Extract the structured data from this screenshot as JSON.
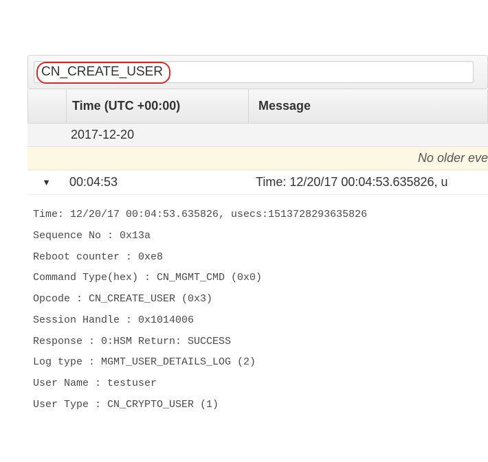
{
  "search": {
    "value": "CN_CREATE_USER"
  },
  "columns": {
    "time": "Time (UTC +00:00)",
    "message": "Message"
  },
  "date_group": "2017-12-20",
  "notice": "No older eve",
  "event": {
    "time": "00:04:53",
    "message": "Time: 12/20/17 00:04:53.635826, u"
  },
  "details": {
    "line0": "Time: 12/20/17 00:04:53.635826, usecs:1513728293635826",
    "line1": "Sequence No : 0x13a",
    "line2": "Reboot counter : 0xe8",
    "line3": "Command Type(hex) : CN_MGMT_CMD (0x0)",
    "line4": "Opcode : CN_CREATE_USER (0x3)",
    "line5": "Session Handle : 0x1014006",
    "line6": "Response : 0:HSM Return: SUCCESS",
    "line7": "Log type : MGMT_USER_DETAILS_LOG (2)",
    "line8": "User Name : testuser",
    "line9": "User Type : CN_CRYPTO_USER (1)"
  }
}
